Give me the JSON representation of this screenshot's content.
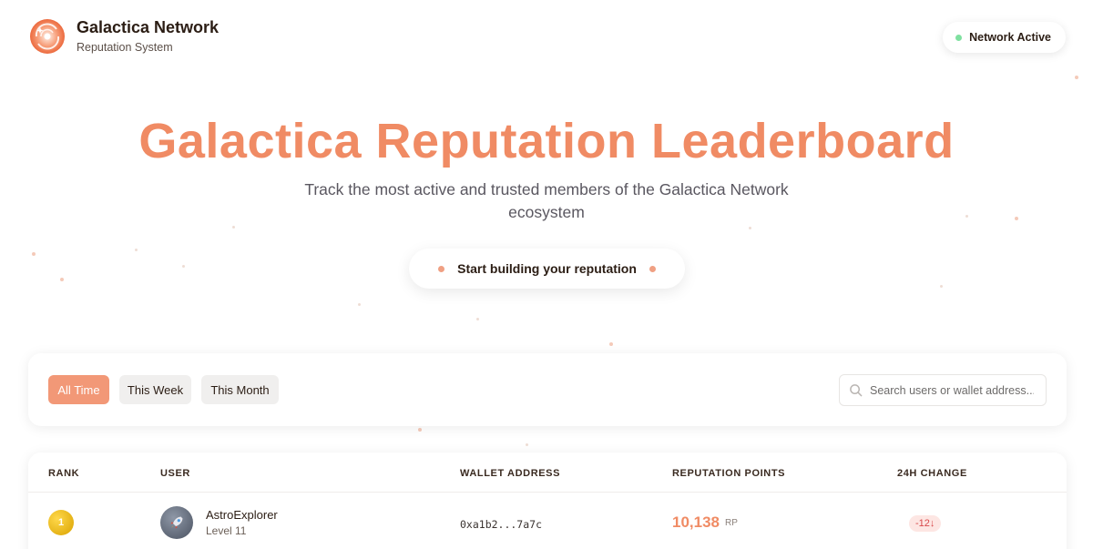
{
  "header": {
    "brand_name": "Galactica Network",
    "brand_subtitle": "Reputation System",
    "logo_icon": "galaxy-logo-icon",
    "network_status": "Network Active",
    "network_status_color": "#7fe0a0"
  },
  "hero": {
    "title": "Galactica Reputation Leaderboard",
    "subtitle": "Track the most active and trusted members of the Galactica Network ecosystem",
    "cta_label": "Start building your reputation"
  },
  "filters": {
    "tabs": [
      {
        "label": "All Time",
        "active": true
      },
      {
        "label": "This Week",
        "active": false
      },
      {
        "label": "This Month",
        "active": false
      }
    ],
    "search_placeholder": "Search users or wallet address...",
    "search_icon": "search-icon"
  },
  "table": {
    "columns": [
      "RANK",
      "USER",
      "WALLET ADDRESS",
      "REPUTATION POINTS",
      "24H CHANGE"
    ],
    "rows": [
      {
        "rank": "1",
        "avatar_icon": "rocket-icon",
        "user": "AstroExplorer",
        "level": "Level 11",
        "wallet": "0xa1b2...7a7c",
        "points": "10,138",
        "points_unit": "RP",
        "change": "-12↓"
      }
    ]
  },
  "colors": {
    "accent": "#f08b64",
    "active_tab": "#f29877",
    "negative_change": "#d8484a",
    "gold_rank": "#e6b410"
  }
}
